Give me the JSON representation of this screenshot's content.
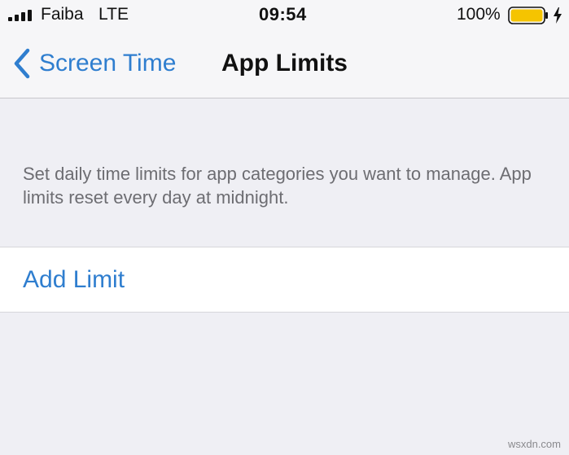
{
  "status_bar": {
    "carrier": "Faiba",
    "network": "LTE",
    "time": "09:54",
    "battery_percent": "100%",
    "battery_level": 1.0,
    "battery_color": "#f5c400",
    "signal_bars": 4,
    "signal_icon": "signal-bars-icon",
    "charging_icon": "charging-bolt-icon"
  },
  "nav": {
    "back_label": "Screen Time",
    "back_icon": "chevron-left-icon",
    "title": "App Limits"
  },
  "main": {
    "description": "Set daily time limits for app categories you want to manage. App limits reset every day at midnight.",
    "add_limit_label": "Add Limit"
  },
  "watermark": "wsxdn.com",
  "colors": {
    "accent": "#2f7ecf",
    "background": "#efeff4",
    "secondary_text": "#6d6d72"
  }
}
